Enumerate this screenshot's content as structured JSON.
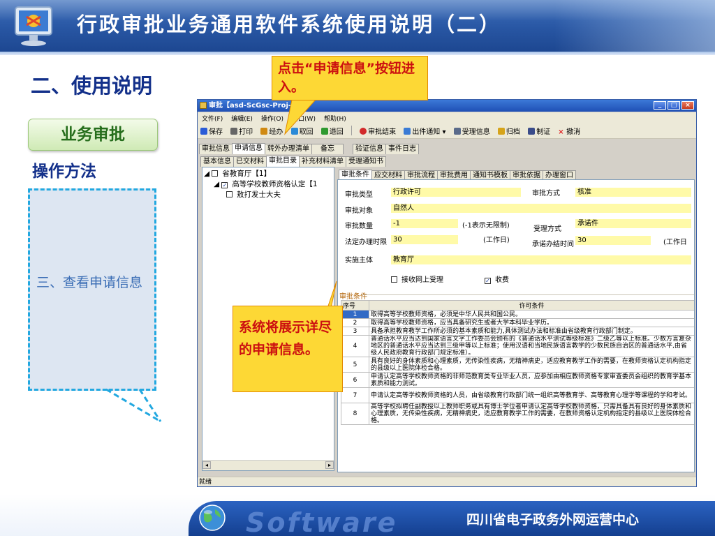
{
  "slide": {
    "title": "行政审批业务通用软件系统使用说明（二）",
    "section_title": "二、使用说明",
    "pill_label": "业务审批",
    "method_label": "操作方法",
    "step_text": "三、查看申请信息",
    "callout_top": "点击“申请信息”按钮进入。",
    "callout_bottom": "系统将展示详尽的申请信息。",
    "footer_brand": "Software",
    "footer_org": "四川省电子政务外网运营中心"
  },
  "window": {
    "title": "审批【asd-ScGsc-Proj-20",
    "menu": [
      "文件(F)",
      "编辑(E)",
      "操作(O)",
      "窗口(W)",
      "帮助(H)"
    ],
    "toolbar": [
      {
        "label": "保存",
        "icon": "save-icon",
        "color": "#2a5bd7"
      },
      {
        "label": "打印",
        "icon": "print-icon",
        "color": "#666666"
      },
      {
        "label": "经办",
        "icon": "handle-icon",
        "color": "#d08a12"
      },
      {
        "label": "取回",
        "icon": "retrieve-icon",
        "color": "#2a8ad7"
      },
      {
        "label": "退回",
        "icon": "return-icon",
        "color": "#2f9a2f"
      },
      {
        "label": "审批结束",
        "icon": "stop-icon",
        "color": "#d22a2a"
      },
      {
        "label": "出件通知",
        "icon": "notice-icon",
        "color": "#3a7bd5"
      },
      {
        "label": "受理信息",
        "icon": "accept-info-icon",
        "color": "#5a6b8a"
      },
      {
        "label": "归档",
        "icon": "archive-icon",
        "color": "#d6a41a"
      },
      {
        "label": "制证",
        "icon": "certificate-icon",
        "color": "#3a4c8a"
      },
      {
        "label": "撤消",
        "icon": "revoke-icon",
        "color": "#e02020"
      }
    ],
    "tabs_main": [
      "审批信息",
      "申请信息",
      "转外办理清单",
      "备忘",
      "验证信息",
      "事件日志"
    ],
    "tabs_sub": [
      "基本信息",
      "已交材料",
      "审批目录",
      "补充材料清单",
      "受理通知书"
    ],
    "tabs_detail": [
      "审批条件",
      "应交材料",
      "审批流程",
      "审批费用",
      "通知书模板",
      "审批依据",
      "办理窗口"
    ],
    "tree": {
      "root": "省教育厅【1】",
      "child": "高等学校教师资格认定【1",
      "leaf": "敖打发士大夫"
    },
    "form": {
      "type_label": "审批类型",
      "type_value": "行政许可",
      "method_label": "审批方式",
      "method_value": "核准",
      "object_label": "审批对象",
      "object_value": "自然人",
      "count_label": "审批数量",
      "count_value": "-1",
      "count_hint": "(-1表示无限制)",
      "accept_label": "受理方式",
      "accept_value": "承诺件",
      "legal_label": "法定办理时限",
      "legal_value": "30",
      "legal_unit": "(工作日)",
      "promise_label": "承诺办结时间",
      "promise_value": "30",
      "promise_unit": "(工作日",
      "entity_label": "实施主体",
      "entity_value": "教育厅",
      "online_label": "接收网上受理",
      "fee_label": "收费",
      "group_label": "审批条件"
    },
    "conditions": {
      "headers": [
        "序号",
        "许可条件"
      ],
      "rows": [
        {
          "no": "1",
          "text": "取得高等学校教师资格，必须是中华人民共和国公民。"
        },
        {
          "no": "2",
          "text": "取得高等学校教师资格，应当具备研究生或者大学本科毕业学历。"
        },
        {
          "no": "3",
          "text": "具备承担教育教学工作所必须的基本素质和能力,具体测试办法和标准由省级教育行政部门制定。"
        },
        {
          "no": "4",
          "text": "普通话水平应当达到国家语言文字工作委员会颁布的《普通话水平测试等级标准》二级乙等以上标准。少数方言复杂地区的普通话水平应当达到三级甲等以上标准；使用汉语和当地民族语言教学的少数民族自治区的普通话水平,由省级人民政府教育行政部门规定标准）。"
        },
        {
          "no": "5",
          "text": "具有良好的身体素质和心理素质，无传染性疾病，无精神病史，适应教育教学工作的需要，在教师资格认定机构指定的县级以上医院体检合格。"
        },
        {
          "no": "6",
          "text": "申请认定高等学校教师资格的非师范教育类专业毕业人员，应参加由相应教师资格专家审查委员会组织的教育学基本素质和能力测试。"
        },
        {
          "no": "7",
          "text": "申请认定高等学校教师资格的人员，由省级教育行政部门统一组织高等教育学、高等教育心理学等课程的学和考试。"
        },
        {
          "no": "8",
          "text": "高等学校拟聘任副教授以上教师职务或具有博士学位者申请认定高等学校教师资格，只需具备具有良好的身体素质和心理素质，无传染性疾病，无精神病史，适应教育教学工作的需要，在教师资格认定机构指定的县级以上医院体检合格。"
        }
      ]
    },
    "status": "就绪"
  },
  "colors": {
    "header_blue": "#2856a3",
    "callout_yellow": "#fdd835",
    "callout_text": "#cc1010",
    "title_navy": "#13308a",
    "dash_border": "#22a8e0",
    "form_value_bg": "#fffaa8",
    "selected_row": "#316ac5"
  }
}
